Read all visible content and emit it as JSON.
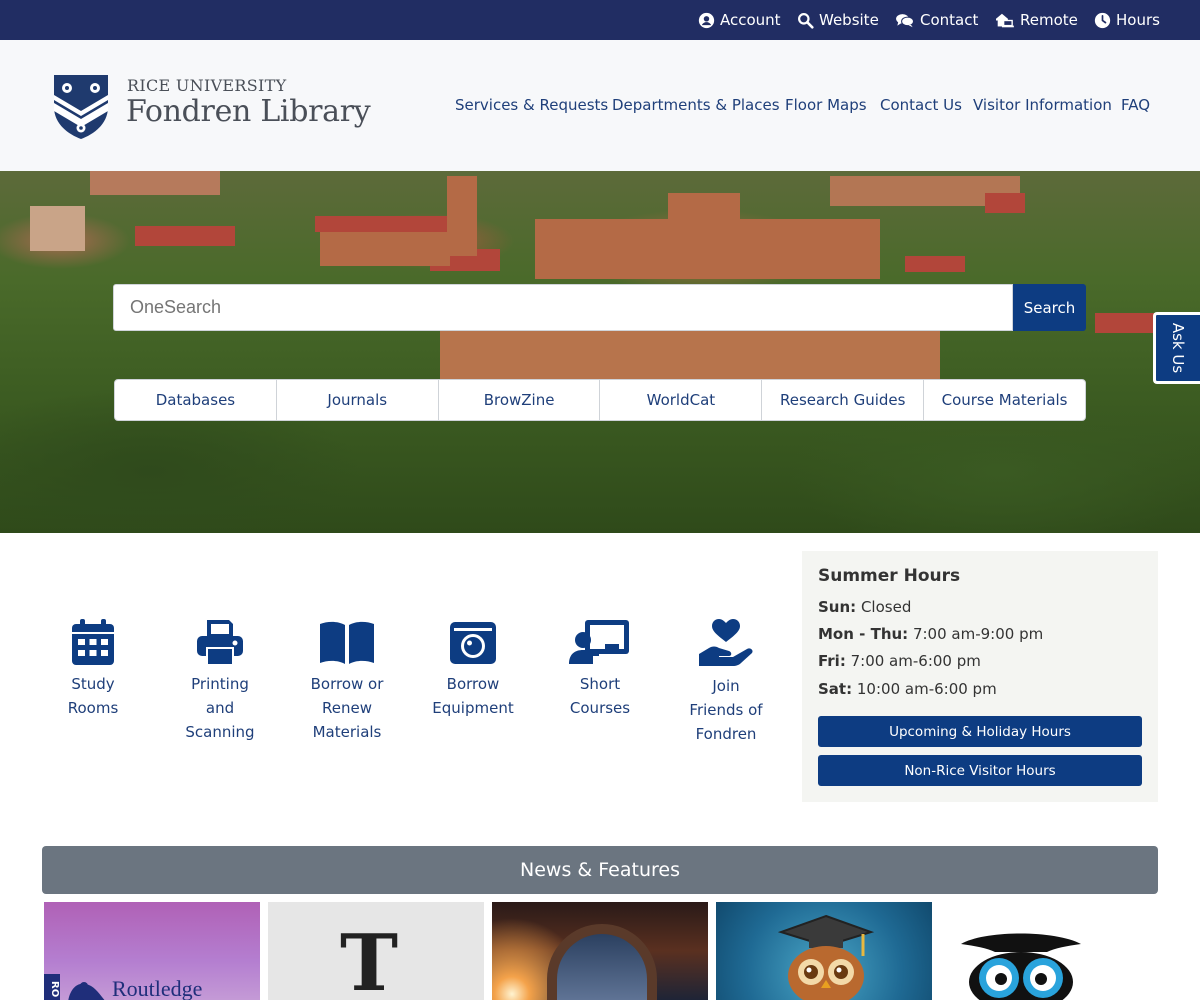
{
  "utility_nav": {
    "items": [
      {
        "label": "Account",
        "icon": "user-circle-icon"
      },
      {
        "label": "Website",
        "icon": "search-icon"
      },
      {
        "label": "Contact",
        "icon": "comments-icon"
      },
      {
        "label": "Remote",
        "icon": "laptop-house-icon"
      },
      {
        "label": "Hours",
        "icon": "clock-icon"
      }
    ]
  },
  "header": {
    "university": "RICE UNIVERSITY",
    "library": "Fondren Library",
    "nav": [
      {
        "label": "Services & Requests"
      },
      {
        "label": "Departments & Places"
      },
      {
        "label": "Floor Maps"
      },
      {
        "label": "Contact Us"
      },
      {
        "label": "Visitor Information"
      },
      {
        "label": "FAQ"
      }
    ]
  },
  "search": {
    "placeholder": "OneSearch",
    "button_label": "Search",
    "quicklinks": [
      {
        "label": "Databases"
      },
      {
        "label": "Journals"
      },
      {
        "label": "BrowZine"
      },
      {
        "label": "WorldCat"
      },
      {
        "label": "Research Guides"
      },
      {
        "label": "Course Materials"
      }
    ]
  },
  "ask_us": {
    "label": "Ask Us"
  },
  "services": [
    {
      "lines": [
        "Study",
        "Rooms"
      ],
      "icon": "calendar-icon"
    },
    {
      "lines": [
        "Printing",
        "and",
        "Scanning"
      ],
      "icon": "printer-icon"
    },
    {
      "lines": [
        "Borrow or",
        "Renew",
        "Materials"
      ],
      "icon": "open-book-icon"
    },
    {
      "lines": [
        "Borrow",
        "Equipment"
      ],
      "icon": "camera-icon"
    },
    {
      "lines": [
        "Short",
        "Courses"
      ],
      "icon": "teacher-icon"
    },
    {
      "lines": [
        "Join",
        "Friends of",
        "Fondren"
      ],
      "icon": "hand-heart-icon"
    }
  ],
  "hours": {
    "title": "Summer Hours",
    "rows": [
      {
        "day": "Sun:",
        "time": "Closed"
      },
      {
        "day": "Mon - Thu:",
        "time": "7:00 am-9:00 pm"
      },
      {
        "day": "Fri:",
        "time": "7:00 am-6:00 pm"
      },
      {
        "day": "Sat:",
        "time": "10:00 am-6:00 pm"
      }
    ],
    "buttons": [
      {
        "label": "Upcoming & Holiday Hours"
      },
      {
        "label": "Non-Rice Visitor Hours"
      }
    ]
  },
  "news": {
    "title": "News & Features",
    "cards": [
      {
        "text": "Routledge",
        "spine": "RO"
      },
      {
        "text": "T"
      },
      {
        "text": ""
      },
      {
        "text": ""
      },
      {
        "text": ""
      }
    ]
  },
  "colors": {
    "topbar": "#212d63",
    "brand_blue": "#0d3c82",
    "link": "#1f3f7a",
    "news_bar": "#6b7580"
  }
}
